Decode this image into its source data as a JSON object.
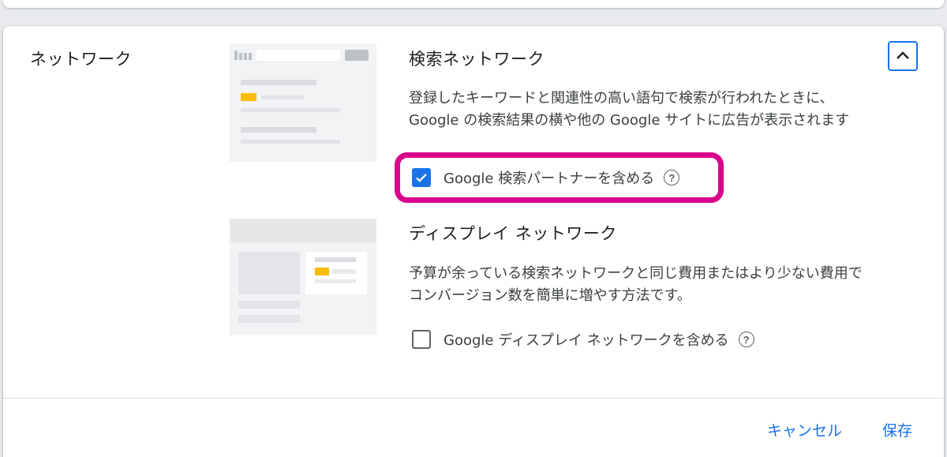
{
  "section": {
    "title": "ネットワーク"
  },
  "search_network": {
    "title": "検索ネットワーク",
    "description": "登録したキーワードと関連性の高い語句で検索が行われたときに、Google の検索結果の横や他の Google サイトに広告が表示されます",
    "checkbox_label": "Google 検索パートナーを含める",
    "checked": true
  },
  "display_network": {
    "title": "ディスプレイ ネットワーク",
    "description": "予算が余っている検索ネットワークと同じ費用またはより少ない費用でコンバージョン数を簡単に増やす方法です。",
    "checkbox_label": "Google ディスプレイ ネットワークを含める",
    "checked": false
  },
  "help_glyph": "?",
  "footer": {
    "cancel_label": "キャンセル",
    "save_label": "保存"
  },
  "colors": {
    "accent": "#1a73e8",
    "highlight": "#d9048b",
    "ad_yellow": "#fbbc04"
  }
}
